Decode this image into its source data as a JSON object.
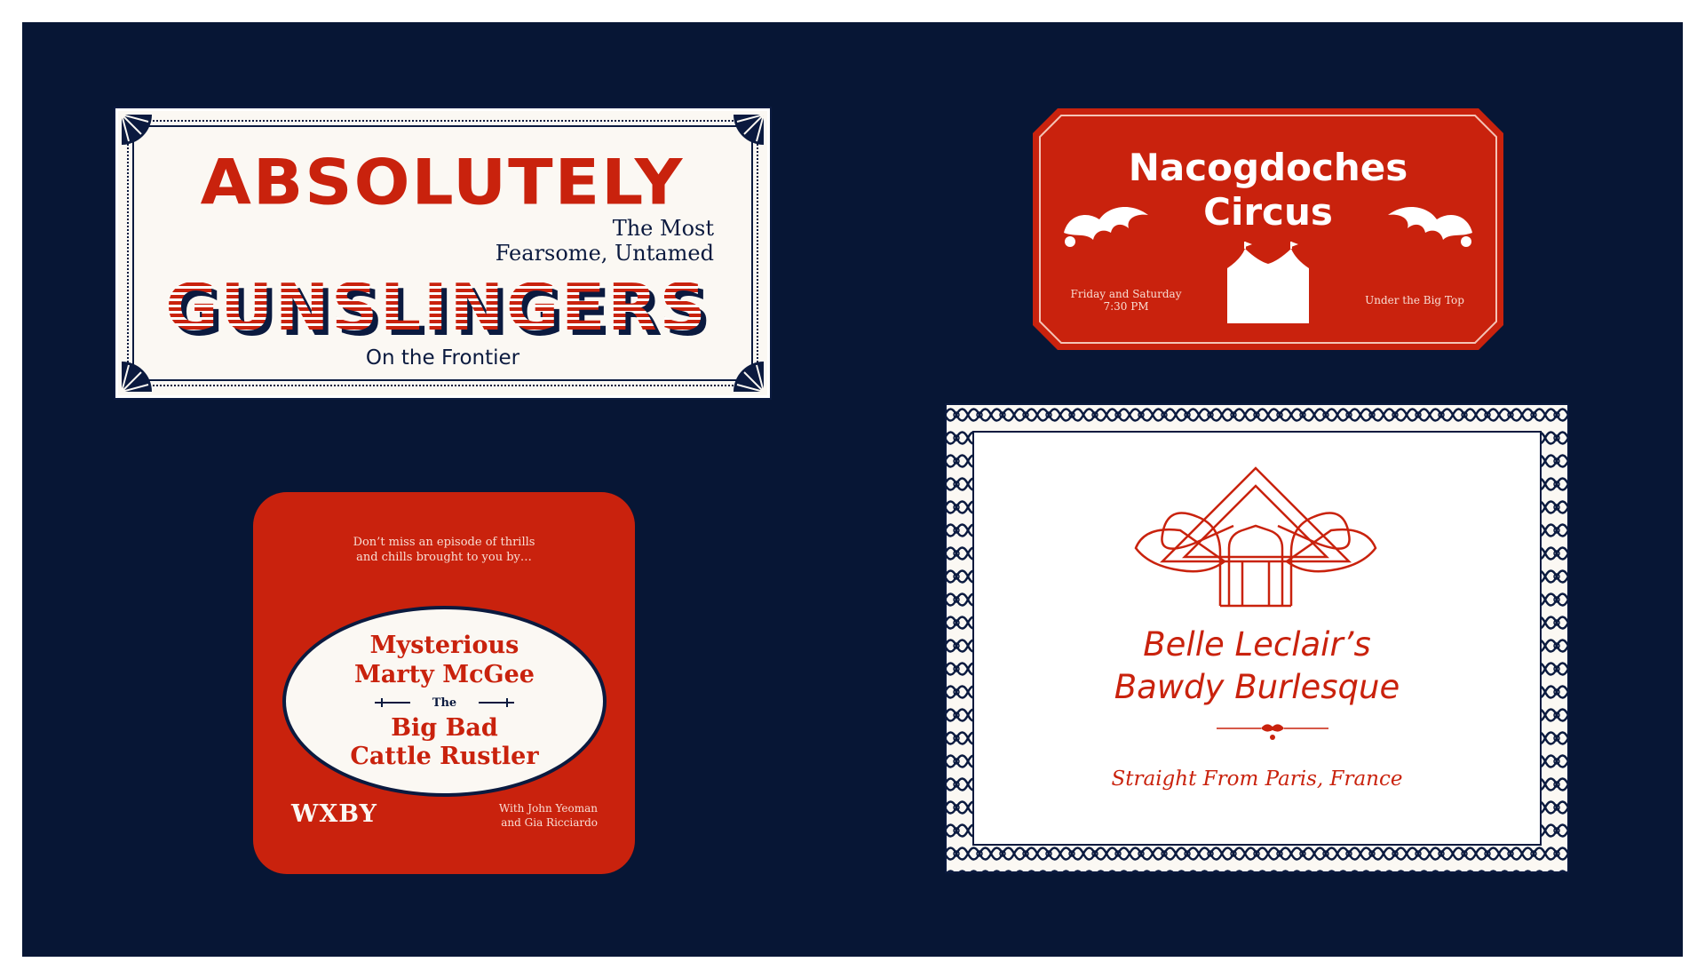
{
  "gunslingers": {
    "headline": "ABSOLUTELY",
    "subtitle_line1": "The Most",
    "subtitle_line2": "Fearsome, Untamed",
    "main": "GUNSLINGERS",
    "footer": "On the Frontier"
  },
  "circus": {
    "title_line1": "Nacogdoches",
    "title_line2": "Circus",
    "left_info_line1": "Friday and Saturday",
    "left_info_line2": "7:30 PM",
    "right_info": "Under the Big Top"
  },
  "radio": {
    "intro_line1": "Don’t miss an episode of thrills",
    "intro_line2": "and chills brought to you by…",
    "show_line1": "Mysterious",
    "show_line2": "Marty McGee",
    "connector": "The",
    "show_line3": "Big Bad",
    "show_line4": "Cattle Rustler",
    "call_sign": "WXBY",
    "credits_line1": "With John Yeoman",
    "credits_line2": "and Gia Ricciardo"
  },
  "burlesque": {
    "name_line1": "Belle Leclair’s",
    "name_line2": "Bawdy Burlesque",
    "tagline": "Straight From Paris, France"
  },
  "colors": {
    "navy": "#071635",
    "red": "#c9220d",
    "cream": "#fbf8f3"
  }
}
